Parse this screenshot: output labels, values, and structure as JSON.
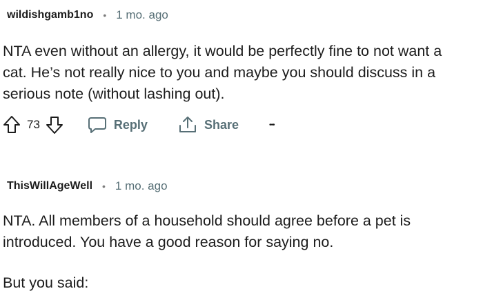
{
  "comments": [
    {
      "username": "wildishgamb1no",
      "separator": "•",
      "time": "1 mo. ago",
      "body": [
        "NTA even without an allergy, it would be perfectly fine to not want a",
        "cat. He’s not really nice to you and maybe you should discuss in a",
        "serious note (without lashing out)."
      ],
      "score": "73",
      "reply_label": "Reply",
      "share_label": "Share",
      "more_label": "•••"
    },
    {
      "username": "ThisWillAgeWell",
      "separator": "•",
      "time": "1 mo. ago",
      "body": [
        "NTA. All members of a household should agree before a pet is",
        "introduced. You have a good reason for saying no."
      ],
      "body2": "But you said:"
    }
  ],
  "icons": {
    "upvote": "upvote-arrow-icon",
    "downvote": "downvote-arrow-icon",
    "reply": "speech-bubble-icon",
    "share": "share-upload-icon"
  },
  "colors": {
    "text": "#1c1c1c",
    "meta": "#576f76",
    "dot": "#7c7c7c"
  }
}
